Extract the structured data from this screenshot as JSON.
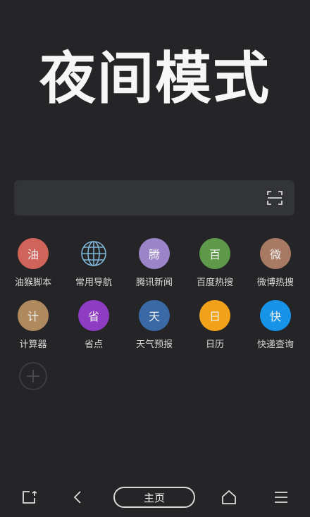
{
  "hero": {
    "title": "夜间模式"
  },
  "search": {
    "placeholder": "",
    "scan_icon": "scan-icon"
  },
  "shortcuts": [
    {
      "label": "油猴脚本",
      "glyph": "油",
      "color": "#d0645a",
      "icon": "monkey-script-icon"
    },
    {
      "label": "常用导航",
      "glyph": "",
      "color": "#252528",
      "icon": "globe-icon"
    },
    {
      "label": "腾讯新闻",
      "glyph": "腾",
      "color": "#9b84c8",
      "icon": "tencent-news-icon"
    },
    {
      "label": "百度热搜",
      "glyph": "百",
      "color": "#5e9a4a",
      "icon": "baidu-hot-icon"
    },
    {
      "label": "微博热搜",
      "glyph": "微",
      "color": "#a87a63",
      "icon": "weibo-hot-icon"
    },
    {
      "label": "计算器",
      "glyph": "计",
      "color": "#b08a5f",
      "icon": "calculator-icon"
    },
    {
      "label": "省点",
      "glyph": "省",
      "color": "#8e3cc2",
      "icon": "save-icon"
    },
    {
      "label": "天气预报",
      "glyph": "天",
      "color": "#3a6aa6",
      "icon": "weather-icon"
    },
    {
      "label": "日历",
      "glyph": "日",
      "color": "#f2a21a",
      "icon": "calendar-icon"
    },
    {
      "label": "快递查询",
      "glyph": "快",
      "color": "#1794e8",
      "icon": "express-icon"
    }
  ],
  "bottom_bar": {
    "home_label": "主页"
  }
}
